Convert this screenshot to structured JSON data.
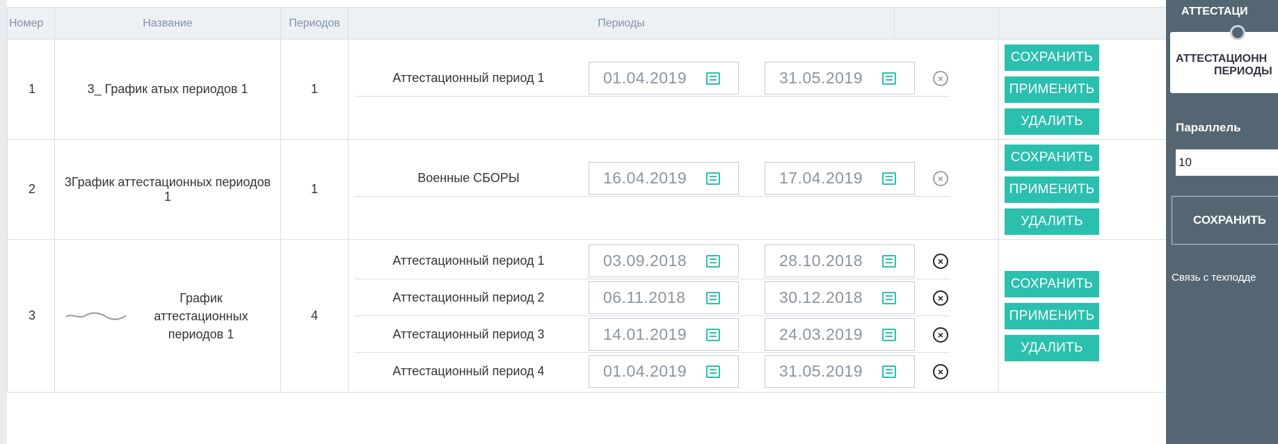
{
  "table": {
    "headers": {
      "num": "Номер",
      "name": "Название",
      "count": "Периодов",
      "periods": "Периоды"
    },
    "rows": [
      {
        "num": "1",
        "name": "3_  График атых периодов 1",
        "count": "1",
        "periods": [
          {
            "label": "Аттестационный период 1",
            "start": "01.04.2019",
            "end": "31.05.2019"
          }
        ]
      },
      {
        "num": "2",
        "name": "3График аттестационных периодов 1",
        "count": "1",
        "periods": [
          {
            "label": "Военные СБОРЫ",
            "start": "16.04.2019",
            "end": "17.04.2019"
          }
        ]
      },
      {
        "num": "3",
        "name": "График аттестационных периодов 1",
        "count": "4",
        "periods": [
          {
            "label": "Аттестационный период 1",
            "start": "03.09.2018",
            "end": "28.10.2018"
          },
          {
            "label": "Аттестационный период 2",
            "start": "06.11.2018",
            "end": "30.12.2018"
          },
          {
            "label": "Аттестационный период 3",
            "start": "14.01.2019",
            "end": "24.03.2019"
          },
          {
            "label": "Аттестационный период 4",
            "start": "01.04.2019",
            "end": "31.05.2019"
          }
        ]
      }
    ],
    "actions": {
      "save": "СОХРАНИТЬ",
      "apply": "ПРИМЕНИТЬ",
      "delete": "УДАЛИТЬ"
    },
    "remove_glyph": "×"
  },
  "sidebar": {
    "top_label": "АТТЕСТАЦИ",
    "card_line1": "АТТЕСТАЦИОНН",
    "card_line2": "ПЕРИОДЫ",
    "parallel_label": "Параллель",
    "parallel_value": "10",
    "save_label": "СОХРАНИТЬ",
    "support_link": "Связь с техподде"
  },
  "colors": {
    "accent": "#2bbfae",
    "sidebar": "#556673",
    "header_bg": "#eef1f4",
    "header_text": "#7a93ab"
  },
  "icons": {
    "calendar": "calendar-icon",
    "remove": "close-circle-icon"
  }
}
